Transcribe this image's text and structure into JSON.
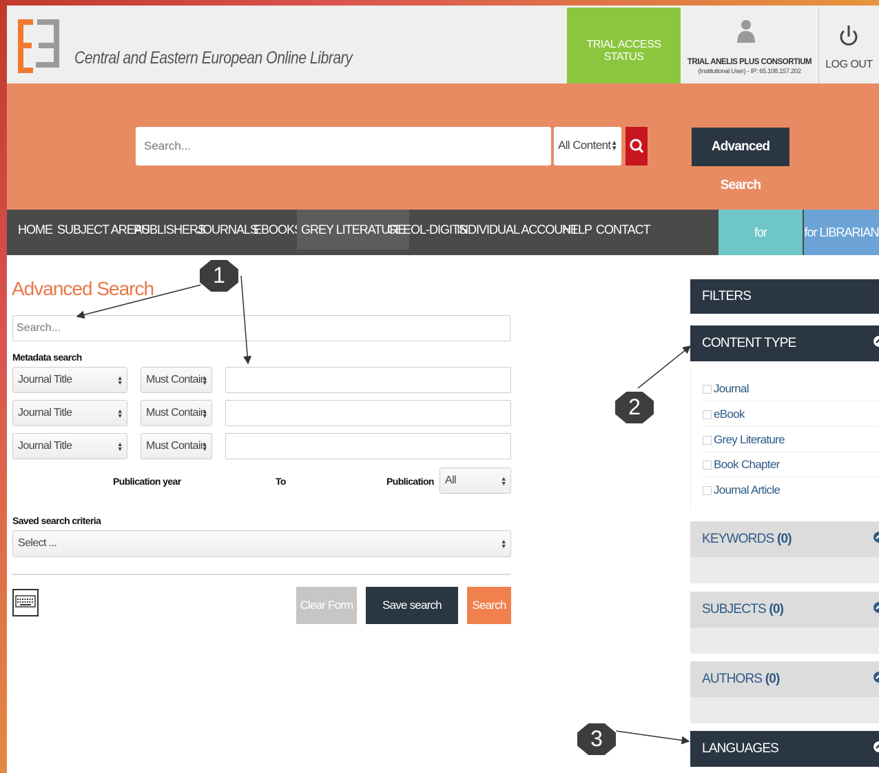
{
  "header": {
    "site_title": "Central and Eastern European Online Library",
    "trial_status": "TRIAL ACCESS STATUS",
    "user_name": "TRIAL ANELIS PLUS CONSORTIUM",
    "user_detail": "(Institutional User) - IP: 65.108.157.202",
    "logout": "LOG OUT"
  },
  "search": {
    "placeholder": "Search...",
    "scope": "All Content",
    "advanced_button": "Advanced Search"
  },
  "nav": {
    "items": [
      "HOME",
      "SUBJECT AREAS",
      "PUBLISHERS",
      "JOURNALS",
      "EBOOKS",
      "GREY LITERATURE",
      "CEEOL-DIGITS",
      "INDIVIDUAL ACCOUNT",
      "HELP",
      "CONTACT"
    ],
    "for_publishers": "for PUBLISHERS",
    "for_librarians": "for LIBRARIANS"
  },
  "advanced": {
    "title": "Advanced Search",
    "search_placeholder": "Search...",
    "metadata_label": "Metadata search",
    "rows": [
      {
        "field": "Journal Title",
        "condition": "Must Contain"
      },
      {
        "field": "Journal Title",
        "condition": "Must Contain"
      },
      {
        "field": "Journal Title",
        "condition": "Must Contain"
      }
    ],
    "pub_year_label": "Publication year",
    "to_label": "To",
    "publication_label": "Publication",
    "publication_value": "All",
    "saved_label": "Saved search criteria",
    "saved_value": "Select ...",
    "clear": "Clear Form",
    "save": "Save search criteria",
    "search": "Search"
  },
  "filters": {
    "title": "FILTERS",
    "content_type": "CONTENT TYPE",
    "content_items": [
      "Journal",
      "eBook",
      "Grey Literature",
      "Book Chapter",
      "Journal Article"
    ],
    "keywords": "KEYWORDS",
    "keywords_count": "(0)",
    "subjects": "SUBJECTS",
    "subjects_count": "(0)",
    "authors": "AUTHORS",
    "authors_count": "(0)",
    "languages": "LANGUAGES"
  },
  "callouts": [
    "1",
    "2",
    "3"
  ],
  "colors": {
    "accent_orange": "#e88b63",
    "dark_navy": "#2b3643",
    "trial_green": "#8cc63f",
    "search_red": "#c7161d"
  }
}
